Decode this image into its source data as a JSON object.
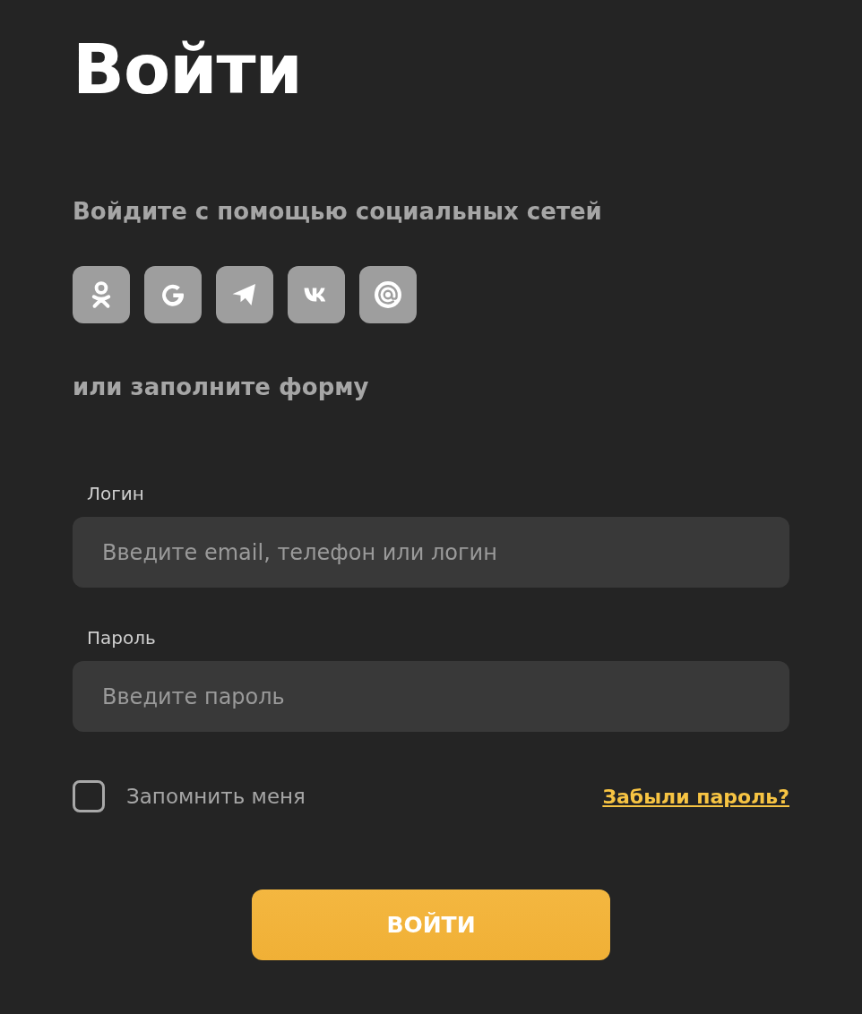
{
  "title": "Войти",
  "social": {
    "heading": "Войдите с помощью социальных сетей",
    "buttons": [
      {
        "kind": "ok"
      },
      {
        "kind": "google"
      },
      {
        "kind": "telegram"
      },
      {
        "kind": "vk"
      },
      {
        "kind": "mail"
      }
    ]
  },
  "form_heading": "или заполните форму",
  "fields": [
    {
      "label": "Логин",
      "placeholder": "Введите email, телефон или логин"
    },
    {
      "label": "Пароль",
      "placeholder": "Введите пароль"
    }
  ],
  "remember": {
    "label": "Запомнить меня",
    "checked": false
  },
  "forgot_link": "Забыли пароль?",
  "submit": "ВОЙТИ"
}
